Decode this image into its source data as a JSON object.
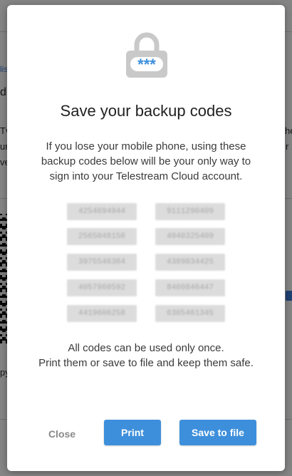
{
  "background": {
    "fragments": [
      "lis",
      "d",
      "Tv",
      "ur",
      "ve",
      "he",
      "r",
      "py"
    ]
  },
  "modal": {
    "title": "Save your backup codes",
    "description": "If you lose your mobile phone, using these backup codes below will be your only way to sign into your Telestream Cloud account.",
    "lock_icon_text": "***",
    "codes": [
      [
        "4254694944",
        "9111290409"
      ],
      [
        "2565048156",
        "4040325409"
      ],
      [
        "3975546384",
        "4389834425"
      ],
      [
        "4057960592",
        "8460846447"
      ],
      [
        "4419606258",
        "6305461345"
      ]
    ],
    "note_line1": "All codes can be used only once.",
    "note_line2": "Print them or save to file and keep them safe.",
    "close_label": "Close",
    "print_label": "Print",
    "save_label": "Save to file"
  },
  "colors": {
    "accent": "#3d8fdb",
    "overlay": "rgba(0,0,0,0.48)",
    "lock": "#c9c9c9",
    "lock_stars": "#3d8fdb"
  }
}
